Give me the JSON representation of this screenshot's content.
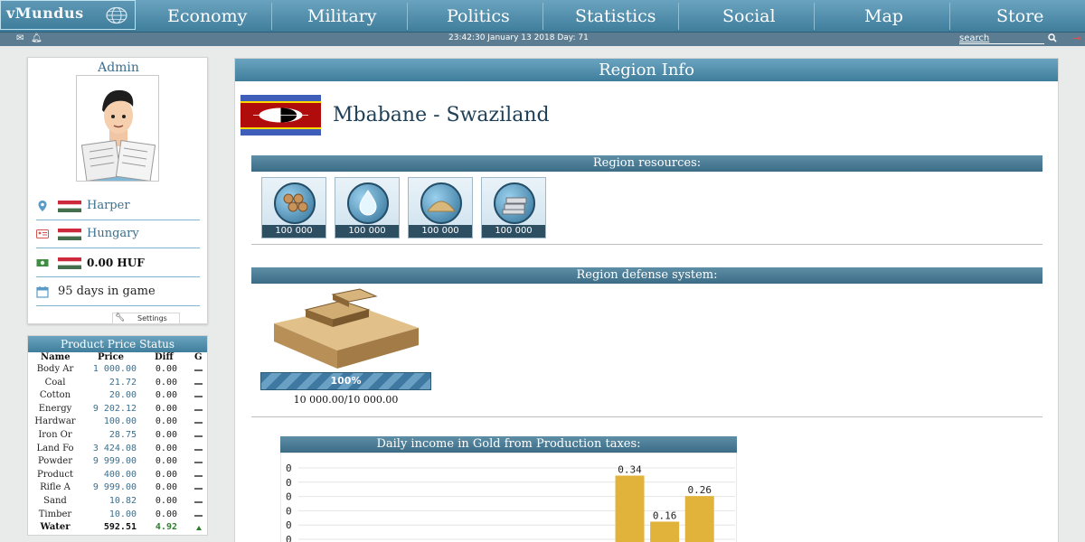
{
  "logo": {
    "text": "vMundus"
  },
  "nav": [
    "Economy",
    "Military",
    "Politics",
    "Statistics",
    "Social",
    "Map",
    "Store"
  ],
  "statusbar": {
    "clock": "23:42:30 January 13 2018  Day: 71",
    "search_placeholder": "search",
    "icons": [
      "mail-icon",
      "bell-icon",
      "search-icon",
      "exit-icon"
    ]
  },
  "profile": {
    "name": "Admin",
    "location": "Harper",
    "citizenship": "Hungary",
    "money": "0.00 HUF",
    "days": "95 days in game",
    "settings": "Settings"
  },
  "prices": {
    "title": "Product Price Status",
    "headers": [
      "Name",
      "Price",
      "Diff",
      "G"
    ],
    "rows": [
      {
        "name": "Body Ar",
        "price": "1 000.00",
        "diff": "0.00"
      },
      {
        "name": "Coal",
        "price": "21.72",
        "diff": "0.00"
      },
      {
        "name": "Cotton",
        "price": "20.00",
        "diff": "0.00"
      },
      {
        "name": "Energy",
        "price": "9 202.12",
        "diff": "0.00"
      },
      {
        "name": "Hardwar",
        "price": "100.00",
        "diff": "0.00"
      },
      {
        "name": "Iron Or",
        "price": "28.75",
        "diff": "0.00"
      },
      {
        "name": "Land Fo",
        "price": "3 424.08",
        "diff": "0.00"
      },
      {
        "name": "Powder",
        "price": "9 999.00",
        "diff": "0.00"
      },
      {
        "name": "Product",
        "price": "400.00",
        "diff": "0.00"
      },
      {
        "name": "Rifle A",
        "price": "9 999.00",
        "diff": "0.00"
      },
      {
        "name": "Sand",
        "price": "10.82",
        "diff": "0.00"
      },
      {
        "name": "Timber",
        "price": "10.00",
        "diff": "0.00"
      },
      {
        "name": "Water",
        "price": "592.51",
        "diff": "4.92",
        "active": true
      }
    ]
  },
  "region": {
    "panel_title": "Region Info",
    "name": "Mbabane - Swaziland",
    "resources_title": "Region resources:",
    "resources": [
      {
        "icon": "timber-icon",
        "amount": "100 000"
      },
      {
        "icon": "water-icon",
        "amount": "100 000"
      },
      {
        "icon": "sand-icon",
        "amount": "100 000"
      },
      {
        "icon": "iron-icon",
        "amount": "100 000"
      }
    ],
    "defense_title": "Region defense system:",
    "defense_percent": "100%",
    "defense_value": "10 000.00/10 000.00",
    "defense_level": 1.0
  },
  "chart_data": {
    "type": "bar",
    "title": "Daily income in Gold from Production taxes:",
    "ytick_labels": [
      "0",
      "0",
      "0",
      "0",
      "0",
      "0"
    ],
    "values": [
      0,
      0,
      0,
      0,
      0,
      0,
      0,
      0,
      0,
      0.34,
      0.16,
      0.26
    ],
    "value_labels": [
      "",
      "",
      "",
      "",
      "",
      "",
      "",
      "",
      "",
      "0.34",
      "0.16",
      "0.26"
    ],
    "ylim": [
      0,
      0.4
    ],
    "grid": true,
    "bar_color": "#e2b33a"
  },
  "colors": {
    "accent": "#4a87a6",
    "link": "#3a6f8f"
  }
}
